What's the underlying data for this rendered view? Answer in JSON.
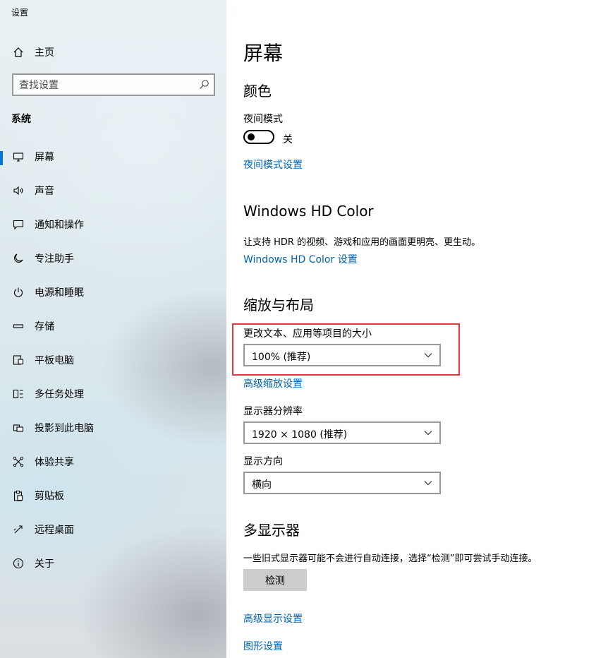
{
  "window": {
    "title": "设置"
  },
  "sidebar": {
    "home_label": "主页",
    "search_placeholder": "查找设置",
    "section_label": "系统",
    "items": [
      {
        "label": "屏幕",
        "icon": "monitor-icon",
        "active": true
      },
      {
        "label": "声音",
        "icon": "speaker-icon"
      },
      {
        "label": "通知和操作",
        "icon": "notification-icon"
      },
      {
        "label": "专注助手",
        "icon": "moon-icon"
      },
      {
        "label": "电源和睡眠",
        "icon": "power-icon"
      },
      {
        "label": "存储",
        "icon": "storage-icon"
      },
      {
        "label": "平板电脑",
        "icon": "tablet-icon"
      },
      {
        "label": "多任务处理",
        "icon": "multitasking-icon"
      },
      {
        "label": "投影到此电脑",
        "icon": "project-icon"
      },
      {
        "label": "体验共享",
        "icon": "share-icon"
      },
      {
        "label": "剪贴板",
        "icon": "clipboard-icon"
      },
      {
        "label": "远程桌面",
        "icon": "remote-desktop-icon"
      },
      {
        "label": "关于",
        "icon": "info-icon"
      }
    ]
  },
  "main": {
    "title": "屏幕",
    "color_section": {
      "heading": "颜色",
      "night_mode_label": "夜间模式",
      "night_mode_state": "关",
      "night_mode_link": "夜间模式设置"
    },
    "hdr_section": {
      "heading": "Windows HD Color",
      "description": "让支持 HDR 的视频、游戏和应用的画面更明亮、更生动。",
      "link": "Windows HD Color 设置"
    },
    "scale_section": {
      "heading": "缩放与布局",
      "scale_label": "更改文本、应用等项目的大小",
      "scale_value": "100% (推荐)",
      "advanced_scale_link": "高级缩放设置",
      "resolution_label": "显示器分辨率",
      "resolution_value": "1920 × 1080 (推荐)",
      "orientation_label": "显示方向",
      "orientation_value": "横向"
    },
    "multi_display": {
      "heading": "多显示器",
      "description": "一些旧式显示器可能不会进行自动连接，选择“检测”即可尝试手动连接。",
      "detect_button": "检测",
      "advanced_display_link": "高级显示设置",
      "graphics_link": "图形设置"
    }
  },
  "colors": {
    "accent": "#0078d7",
    "link": "#0063b1",
    "highlight_box": "#e03a3e"
  }
}
